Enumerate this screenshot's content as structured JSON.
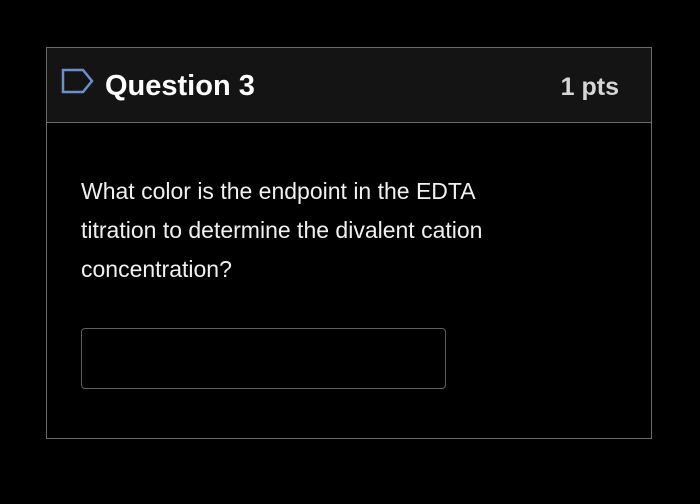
{
  "question": {
    "title": "Question 3",
    "points": "1 pts",
    "text": "What color is the endpoint in the EDTA titration to determine the divalent cation concentration?",
    "answer_value": "",
    "flag_icon": "flag-outline-icon"
  },
  "colors": {
    "background": "#000000",
    "header_background": "#141414",
    "border": "#6b6b6b",
    "flag_icon_color": "#6d8fc9",
    "title_text": "#ffffff",
    "points_text": "#d6d6d6"
  }
}
